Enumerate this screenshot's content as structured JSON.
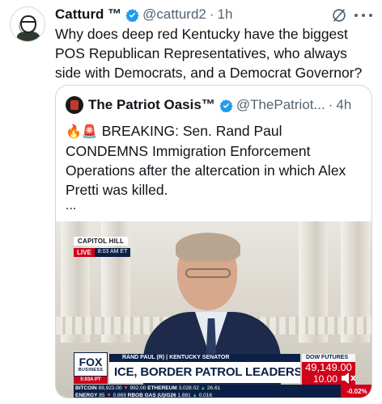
{
  "tweet": {
    "author_name": "Catturd ™",
    "handle": "@catturd2",
    "separator": "·",
    "time": "1h",
    "text": "Why does deep red Kentucky have the biggest POS Republican Representatives, who always side with Democrats, and a Democrat Governor?"
  },
  "quote": {
    "author_name": "The Patriot Oasis™",
    "handle": "@ThePatriot...",
    "separator": "·",
    "time": "4h",
    "emoji": "🔥🚨",
    "text": "BREAKING: Sen. Rand Paul CONDEMNS Immigration Enforcement Operations after the altercation in which Alex Pretti was killed.",
    "ellipsis": "..."
  },
  "video": {
    "location": "CAPITOL HILL",
    "live": "LIVE",
    "bug_time": "8:03 AM ET",
    "network_line1": "FOX",
    "network_line2": "BUSINESS",
    "network_time": "5:03A PT",
    "nameplate": "RAND PAUL (R) | KENTUCKY SENATOR",
    "headline": "ICE, BORDER PATROL LEADERS TO TESTIFY",
    "dow_label": "DOW FUTURES",
    "dow_value": "49,149.00",
    "dow_change": "10.00",
    "dow_pct": "-0.02%",
    "ticker_row1": [
      {
        "sym": "BITCOIN",
        "val": "89,922.00",
        "dir": "down",
        "chg": "992.00"
      },
      {
        "sym": "ETHEREUM",
        "val": "3,028.02",
        "dir": "up",
        "chg": "26.61"
      }
    ],
    "ticker_row2": [
      {
        "sym": "ENERGY",
        "val": "85",
        "dir": "down",
        "chg": "0.869"
      },
      {
        "sym": "RBOB GAS (U)/G26",
        "val": "1.881",
        "dir": "up",
        "chg": "0.016"
      }
    ]
  },
  "icons": {
    "verified": "verified-badge-icon",
    "grok": "grok-icon",
    "more": "more-icon",
    "mute": "mute-icon"
  },
  "colors": {
    "verified_blue": "#1d9bf0",
    "text_primary": "#0f1419",
    "text_secondary": "#536471",
    "fox_red": "#d0021b",
    "fox_navy": "#0b2046"
  }
}
